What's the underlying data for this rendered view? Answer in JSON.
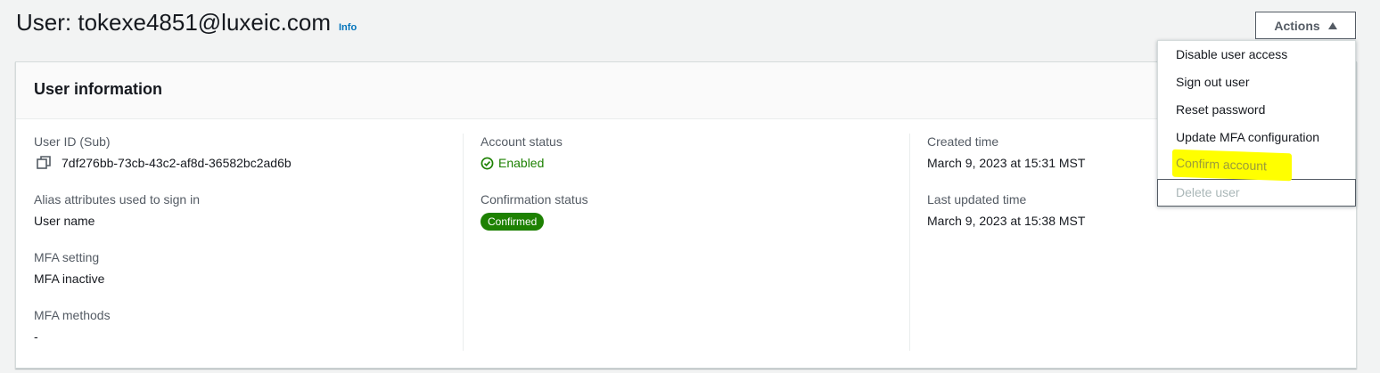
{
  "header": {
    "title": "User: tokexe4851@luxeic.com",
    "info_label": "Info",
    "actions_label": "Actions"
  },
  "panel": {
    "title": "User information",
    "columns": [
      {
        "fields": [
          {
            "label": "User ID (Sub)",
            "value": "7df276bb-73cb-43c2-af8d-36582bc2ad6b",
            "icon": "copy-icon"
          },
          {
            "label": "Alias attributes used to sign in",
            "value": "User name"
          },
          {
            "label": "MFA setting",
            "value": "MFA inactive"
          },
          {
            "label": "MFA methods",
            "value": "-"
          }
        ]
      },
      {
        "fields": [
          {
            "label": "Account status",
            "value": "Enabled",
            "icon": "check-circle-icon",
            "color": "#1d8102"
          },
          {
            "label": "Confirmation status",
            "value": "Confirmed",
            "badge_color": "#1d8102"
          }
        ]
      },
      {
        "fields": [
          {
            "label": "Created time",
            "value": "March 9, 2023 at 15:31 MST"
          },
          {
            "label": "Last updated time",
            "value": "March 9, 2023 at 15:38 MST"
          }
        ]
      }
    ]
  },
  "actions_menu": {
    "items": [
      {
        "label": "Disable user access"
      },
      {
        "label": "Sign out user"
      },
      {
        "label": "Reset password"
      },
      {
        "label": "Update MFA configuration"
      },
      {
        "label": "Confirm account",
        "highlighted": true,
        "highlight_color": "#ffff00"
      },
      {
        "label": "Delete user",
        "disabled": true
      }
    ]
  }
}
